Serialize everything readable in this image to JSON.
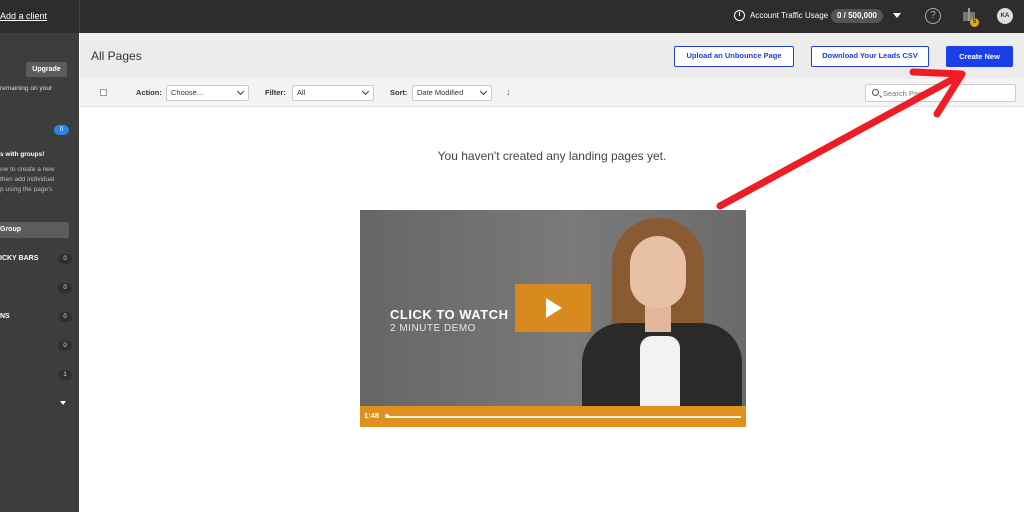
{
  "topbar": {
    "add_client": "Add a client",
    "traffic_label": "Account Traffic Usage",
    "traffic_value": "0 / 500,000",
    "info_glyph": "i",
    "help_glyph": "?",
    "gift_badge": "5",
    "avatar_initials": "KA"
  },
  "sidebar": {
    "upgrade": "Upgrade",
    "remaining": "remaining on your",
    "blue_count": "0",
    "groups_title": "s with groups!",
    "groups_desc": [
      "ow to create a new",
      "then add individual",
      "p using the page's"
    ],
    "group_button": "Group",
    "rows": [
      {
        "label": "ICKY BARS",
        "count": "0"
      },
      {
        "label": "",
        "count": "0"
      },
      {
        "label": "NS",
        "count": "0"
      },
      {
        "label": "",
        "count": "0"
      },
      {
        "label": "",
        "count": "1"
      }
    ]
  },
  "header": {
    "title": "All Pages",
    "upload_button": "Upload an Unbounce Page",
    "download_button": "Download Your Leads CSV",
    "create_button": "Create New"
  },
  "filterbar": {
    "action_label": "Action:",
    "action_value": "Choose...",
    "filter_label": "Filter:",
    "filter_value": "All",
    "sort_label": "Sort:",
    "sort_value": "Date Modified",
    "sort_direction_glyph": "↓",
    "search_placeholder": "Search Pages"
  },
  "main": {
    "empty_message": "You haven't created any landing pages yet."
  },
  "video": {
    "headline": "CLICK TO WATCH",
    "subline": "2 MINUTE DEMO",
    "timecode": "1:48"
  },
  "colors": {
    "accent": "#1a3fe6",
    "annotation_arrow": "#ee1c24",
    "video_bar": "#e0901f"
  }
}
